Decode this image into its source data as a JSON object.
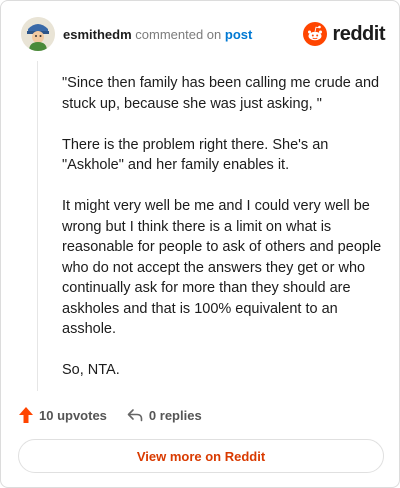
{
  "header": {
    "username": "esmithedm",
    "action_text": "commented on",
    "post_link": "post",
    "brand_name": "reddit"
  },
  "comment": {
    "paragraphs": [
      "\"Since then family has been calling me crude and stuck up, because she was just asking, \"",
      "There is the problem right there. She's an \"Askhole\" and her family enables it.",
      "It might very well be me and I could very well be wrong but I think there is a limit on what is reasonable for people to ask of others and people who do not accept the answers they get or who continually ask for more than they should are askholes and that is 100% equivalent to an asshole.",
      "So, NTA."
    ]
  },
  "actions": {
    "upvotes_label": "10 upvotes",
    "replies_label": "0 replies"
  },
  "footer": {
    "view_more_label": "View more on Reddit"
  },
  "colors": {
    "brand_orange": "#ff4500",
    "link_blue": "#0079d3",
    "view_more_text": "#d93a00"
  },
  "icons": {
    "avatar": "avatar",
    "logo": "reddit-snoo-icon",
    "upvote": "upvote-arrow-icon",
    "reply": "reply-arrow-icon"
  }
}
